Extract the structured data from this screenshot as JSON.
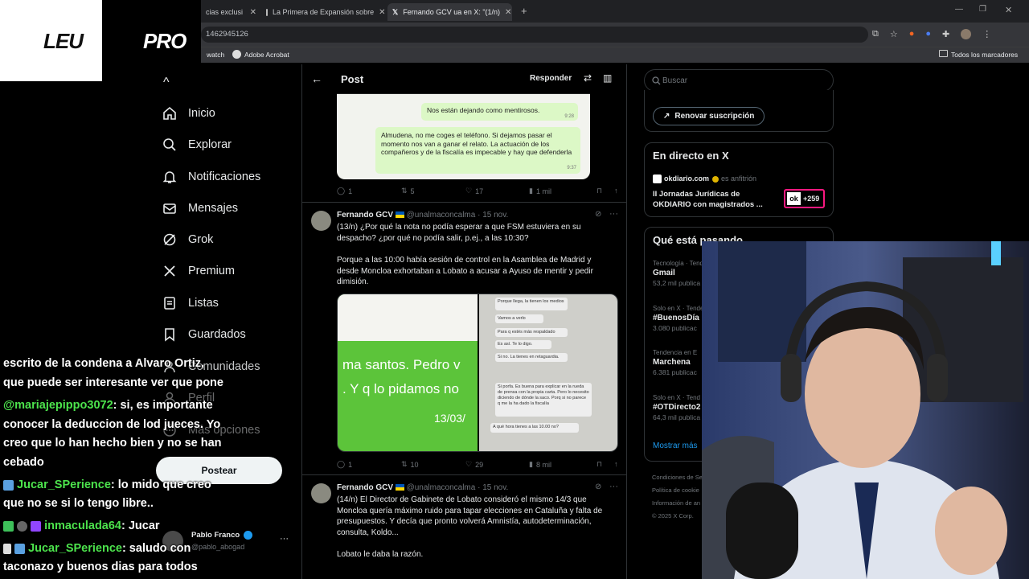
{
  "browser": {
    "tabs": [
      {
        "label": "cias exclusi"
      },
      {
        "label": "La Primera de Expansión sobre"
      },
      {
        "label": "Fernando GCV ua en X: \"(1/n)"
      }
    ],
    "url": "1462945126",
    "bookmarks": {
      "item1": "watch",
      "item2": "Adobe Acrobat",
      "all": "Todos los marcadores"
    }
  },
  "overlay_logo": {
    "left": "LEU",
    "right": "PRO"
  },
  "nav": {
    "items": [
      {
        "label": "Inicio"
      },
      {
        "label": "Explorar"
      },
      {
        "label": "Notificaciones"
      },
      {
        "label": "Mensajes"
      },
      {
        "label": "Grok"
      },
      {
        "label": "Premium"
      },
      {
        "label": "Listas"
      },
      {
        "label": "Guardados"
      },
      {
        "label": "Comunidades"
      },
      {
        "label": "Perfil"
      },
      {
        "label": "Más opciones"
      }
    ],
    "post_button": "Postear",
    "account": {
      "name": "Pablo Franco",
      "handle": "@pablo_abogad"
    }
  },
  "feed": {
    "header": {
      "title": "Post",
      "reply": "Responder"
    },
    "top_image": {
      "bubble1": "Nos están dejando como mentirosos.",
      "bubble1_time": "9:28",
      "bubble2": "Almudena, no me coges el teléfono. Si dejamos pasar el momento nos van a ganar el relato. La actuación de los compañeros y de la fiscalía es impecable y hay que defenderla",
      "bubble2_time": "9:37"
    },
    "top_actions": {
      "replies": "1",
      "reposts": "5",
      "likes": "17",
      "views": "1 mil"
    },
    "tweets": [
      {
        "name": "Fernando GCV",
        "handle": "@unalmaconcalma",
        "date": "· 15 nov.",
        "para1": "(13/n) ¿Por qué la nota no podía esperar a que FSM estuviera en su despacho? ¿por qué no podía salir, p.ej., a las 10:30?",
        "para2": "Porque a las 10:00 había sesión de control en la Asamblea de Madrid y desde Moncloa exhortaban a Lobato a acusar a Ayuso de mentir y pedir dimisión.",
        "img_left": [
          "ma santos. Pedro v",
          ". Y q lo pidamos no",
          "13/03/"
        ],
        "img_right": [
          "Porque llega, la tienen los medios",
          "Vamos a verlo",
          "Para q estés más respaldado",
          "Es así. Te lo digo.",
          "Si no. La tienes en retaguardia.",
          "Si porfa. Es buena para explicar en la rueda de prensa con la propia carta. Pero lo necesito diciendo de dónde la saco. Porq si no parece q me la ha dado la fiscalía",
          "A qué hora tienes a las 10.00 no?"
        ],
        "actions": {
          "replies": "1",
          "reposts": "10",
          "likes": "29",
          "views": "8 mil"
        }
      },
      {
        "name": "Fernando GCV",
        "handle": "@unalmaconcalma",
        "date": "· 15 nov.",
        "para1": "(14/n) El Director de Gabinete de Lobato consideró el mismo 14/3 que Moncloa quería máximo ruido para tapar elecciones en Cataluña y falta de presupuestos. Y decía que pronto volverá Amnistía, autodeterminación, consulta, Koldo...",
        "para2": "Lobato le daba la razón."
      }
    ]
  },
  "sidebar": {
    "search_placeholder": "Buscar",
    "renew": "Renovar suscripción",
    "live": {
      "title": "En directo en X",
      "host": "okdiario.com",
      "host_role": "es anfitrión",
      "event": "II Jornadas Jurídicas de OKDIARIO con magistrados ...",
      "listeners": "+259",
      "badge": "ok"
    },
    "trends": {
      "title": "Qué está pasando",
      "items": [
        {
          "context": "Tecnología · Tende",
          "topic": "Gmail",
          "count": "53,2 mil publica"
        },
        {
          "context": "Solo en X · Tende",
          "topic": "#BuenosDía",
          "count": "3.080 publicac"
        },
        {
          "context": "Tendencia en E",
          "topic": "Marchena",
          "count": "6.381 publicac"
        },
        {
          "context": "Solo en X · Tend",
          "topic": "#OTDirecto2",
          "count": "64,3 mil publica"
        }
      ],
      "show_more": "Mostrar más"
    },
    "footer": {
      "line1": "Condiciones de Se",
      "line2": "Política de cookie",
      "line3": "Información de an",
      "line4": "© 2025 X Corp."
    }
  },
  "chat": {
    "line1": "escrito de la condena a Alvaro Ortiz,",
    "line2": "que puede ser interesante ver que pone",
    "msg1_user": "@mariajepippo3072",
    "msg1_text": ": si, es importante",
    "line4": "conocer la deduccion de lod jueces. Yo",
    "line5": "creo que lo han hecho bien y no se han",
    "line6": "cebado",
    "msg2_user": "Jucar_SPerience",
    "msg2_text": ": lo mido que creo",
    "line8": "que no se si lo tengo libre..",
    "msg3_user": "inmaculada64",
    "msg3_text": ": Jucar",
    "msg4_user": "Jucar_SPerience",
    "msg4_text": ": saludo con",
    "line11": "taconazo y buenos dias para todos"
  },
  "colors": {
    "chat_user": "#4ce34c",
    "accent": "#1d9bf0",
    "live_badge": "#f91880"
  }
}
